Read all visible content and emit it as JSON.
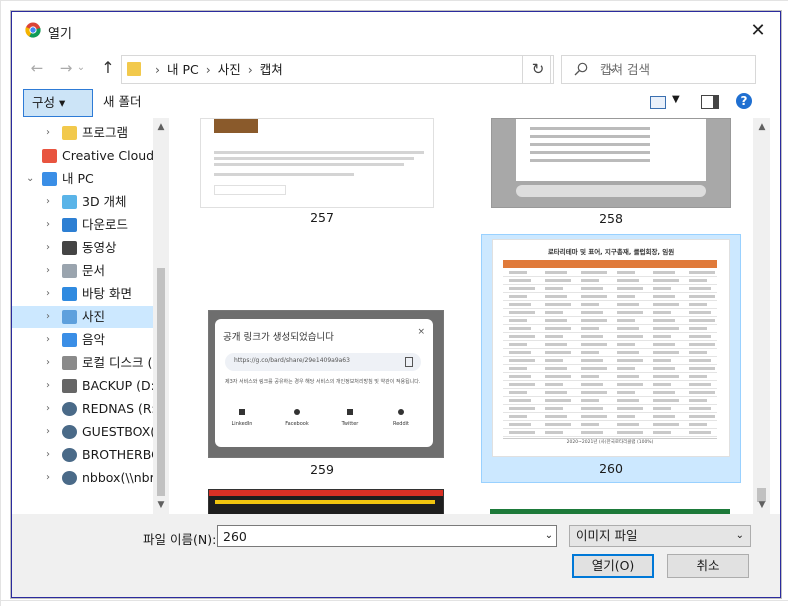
{
  "dialog": {
    "title": "열기",
    "close_glyph": "✕"
  },
  "address": {
    "crumbs": [
      "내 PC",
      "사진",
      "캡쳐"
    ],
    "separator": "›"
  },
  "search": {
    "placeholder": "캡쳐 검색"
  },
  "toolbar": {
    "organize_label": "구성 ▾",
    "new_folder_label": "새 폴더"
  },
  "nav": {
    "items": [
      {
        "label": "프로그램",
        "icon": "folder-icon",
        "indent": 2
      },
      {
        "label": "Creative Cloud Fil",
        "icon": "creative-cloud-icon",
        "indent": 1
      },
      {
        "label": "내 PC",
        "icon": "pc-icon",
        "indent": 1
      },
      {
        "label": "3D 개체",
        "icon": "cube-3d-icon",
        "indent": 2
      },
      {
        "label": "다운로드",
        "icon": "download-icon",
        "indent": 2
      },
      {
        "label": "동영상",
        "icon": "video-icon",
        "indent": 2
      },
      {
        "label": "문서",
        "icon": "document-icon",
        "indent": 2
      },
      {
        "label": "바탕 화면",
        "icon": "desktop-icon",
        "indent": 2
      },
      {
        "label": "사진",
        "icon": "pictures-icon",
        "indent": 2
      },
      {
        "label": "음악",
        "icon": "music-icon",
        "indent": 2
      },
      {
        "label": "로컬 디스크 (C:)",
        "icon": "local-disk-icon",
        "indent": 2
      },
      {
        "label": "BACKUP (D:)",
        "icon": "drive-icon",
        "indent": 2
      },
      {
        "label": "REDNAS (R:)",
        "icon": "network-drive-icon",
        "indent": 2
      },
      {
        "label": "GUESTBOX(\\\\nt",
        "icon": "network-drive-icon",
        "indent": 2
      },
      {
        "label": "BROTHERBOX(\\\\",
        "icon": "network-drive-icon",
        "indent": 2
      },
      {
        "label": "nbbox(\\\\nbrot",
        "icon": "network-drive-icon",
        "indent": 2
      }
    ]
  },
  "files": [
    {
      "name": "257"
    },
    {
      "name": "258"
    },
    {
      "name": "259"
    },
    {
      "name": "260"
    }
  ],
  "thumb259": {
    "heading": "공개 링크가 생성되었습니다",
    "url": "https://g.co/bard/share/29e1409a9a63",
    "note": "제3자 서비스와 링크를 공유하는 경우 해당 서비스의 개인정보처리방침 및 약관이 적용됩니다.",
    "share": [
      "LinkedIn",
      "Facebook",
      "Twitter",
      "Reddit"
    ]
  },
  "thumb260": {
    "heading": "로타리테마 및 표어, 지구총재, 클럽회장, 임원",
    "footer": "2020~2021년 (사)한국로타리클럽 (100%)"
  },
  "bottom": {
    "filename_label": "파일 이름(N):",
    "filename_value": "260",
    "filetype_value": "이미지 파일",
    "open_label": "열기(O)",
    "cancel_label": "취소"
  }
}
